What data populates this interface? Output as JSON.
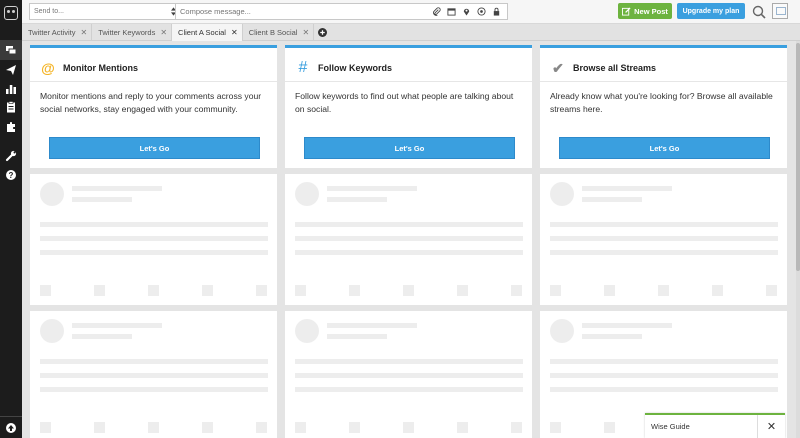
{
  "topbar": {
    "send_to_placeholder": "Send to...",
    "compose_placeholder": "Compose message...",
    "new_post_label": "New Post",
    "upgrade_label": "Upgrade my plan"
  },
  "tabs": [
    {
      "label": "Twitter Activity",
      "active": false
    },
    {
      "label": "Twitter Keywords",
      "active": false
    },
    {
      "label": "Client A Social",
      "active": true
    },
    {
      "label": "Client B Social",
      "active": false
    }
  ],
  "cards": [
    {
      "icon": "@",
      "icon_color": "#f4b324",
      "title": "Monitor Mentions",
      "description": "Monitor mentions and reply to your comments across your social networks, stay engaged with your community.",
      "button": "Let's Go"
    },
    {
      "icon": "#",
      "icon_color": "#3a9fdf",
      "title": "Follow Keywords",
      "description": "Follow keywords to find out what people are talking about on social.",
      "button": "Let's Go"
    },
    {
      "icon": "✔",
      "icon_color": "#888888",
      "title": "Browse all Streams",
      "description": "Already know what you're looking for? Browse all available streams here.",
      "button": "Let's Go"
    }
  ],
  "wise_guide": {
    "label": "Wise Guide"
  },
  "colors": {
    "accent": "#3a9fdf",
    "new_post": "#6db33f",
    "sidebar": "#1c1c1c"
  },
  "icons": [
    "owl-logo-icon",
    "streams-icon",
    "publisher-icon",
    "analytics-icon",
    "assignments-icon",
    "apps-icon",
    "tools-icon",
    "help-icon",
    "attach-icon",
    "calendar-icon",
    "location-icon",
    "targeting-icon",
    "lock-icon",
    "search-icon"
  ]
}
